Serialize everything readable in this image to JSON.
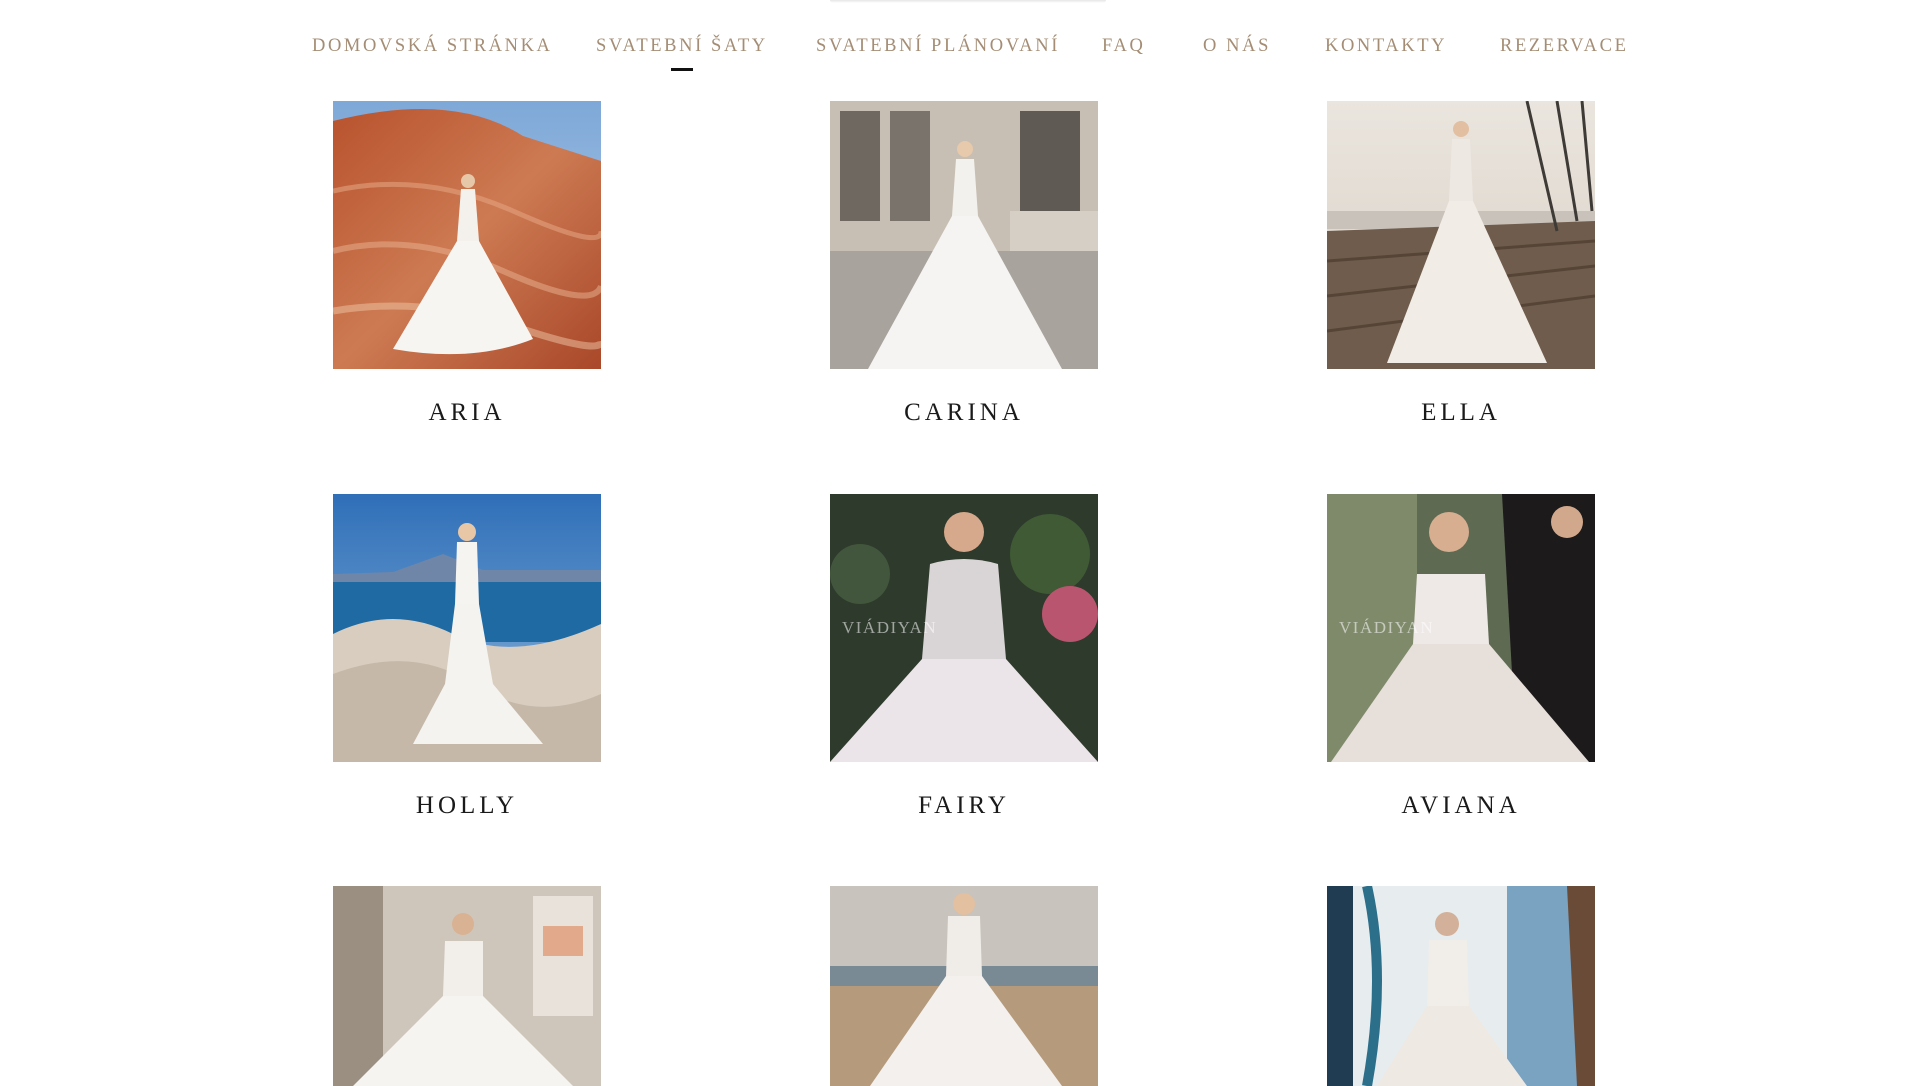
{
  "nav": {
    "items": [
      {
        "label": "DOMOVSKÁ STRÁNKA",
        "active": false
      },
      {
        "label": "SVATEBNÍ ŠATY",
        "active": true
      },
      {
        "label": "SVATEBNÍ PLÁNOVANÍ",
        "active": false
      },
      {
        "label": "FAQ",
        "active": false
      },
      {
        "label": "O NÁS",
        "active": false
      },
      {
        "label": "KONTAKTY",
        "active": false
      },
      {
        "label": "REZERVACE",
        "active": false
      }
    ]
  },
  "dresses": [
    {
      "name": "ARIA"
    },
    {
      "name": "CARINA"
    },
    {
      "name": "ELLA"
    },
    {
      "name": "HOLLY"
    },
    {
      "name": "FAIRY",
      "watermark": "VIÁDIYAN"
    },
    {
      "name": "AVIANA",
      "watermark": "VIÁDIYAN"
    },
    {
      "name": ""
    },
    {
      "name": ""
    },
    {
      "name": ""
    }
  ],
  "colors": {
    "nav_text": "#a48d74",
    "nav_active_underline": "#111111",
    "card_title": "#1a1a1a",
    "background": "#ffffff"
  }
}
